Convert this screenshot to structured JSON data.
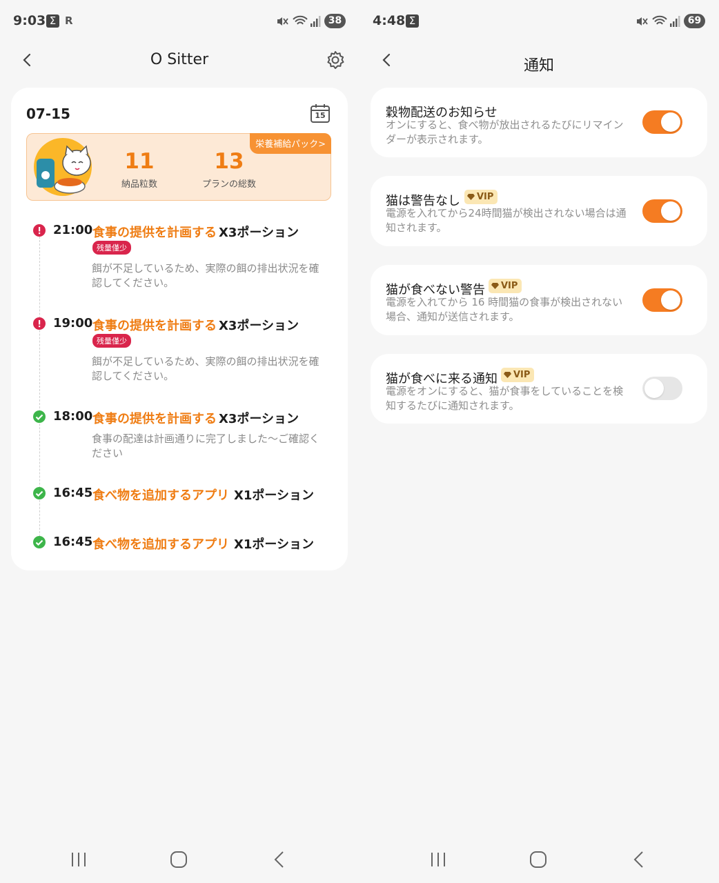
{
  "left": {
    "status": {
      "time": "9:03",
      "battery": "38"
    },
    "header": {
      "title": "O Sitter"
    },
    "card": {
      "date": "07-15",
      "calendar_day": "15",
      "summary": {
        "delivered_value": "11",
        "delivered_label": "納品粒数",
        "plans_value": "13",
        "plans_label": "プランの総数",
        "pack_label": "栄養補給パック>"
      },
      "timeline": [
        {
          "time": "21:00",
          "action": "食事の提供を計画する",
          "qty": "X3ポーション",
          "status": "warn",
          "badge": "残量僅少",
          "note": "餌が不足しているため、実際の餌の排出状況を確認してください。"
        },
        {
          "time": "19:00",
          "action": "食事の提供を計画する",
          "qty": "X3ポーション",
          "status": "warn",
          "badge": "残量僅少",
          "note": "餌が不足しているため、実際の餌の排出状況を確認してください。"
        },
        {
          "time": "18:00",
          "action": "食事の提供を計画する",
          "qty": "X3ポーション",
          "status": "ok",
          "note": "食事の配達は計画通りに完了しました〜ご確認ください"
        },
        {
          "time": "16:45",
          "action": "食べ物を追加するアプリ",
          "qty": "X1ポーション",
          "status": "ok"
        },
        {
          "time": "16:45",
          "action": "食べ物を追加するアプリ",
          "qty": "X1ポーション",
          "status": "ok"
        }
      ]
    }
  },
  "right": {
    "status": {
      "time": "4:48",
      "battery": "69"
    },
    "header": {
      "title": "通知"
    },
    "settings": [
      {
        "title": "穀物配送のお知らせ",
        "vip": false,
        "desc": "オンにすると、食べ物が放出されるたびにリマインダーが表示されます。",
        "enabled": true
      },
      {
        "title": "猫は警告なし",
        "vip": true,
        "vip_label": "VIP",
        "desc": "電源を入れてから24時間猫が検出されない場合は通知されます。",
        "enabled": true
      },
      {
        "title": "猫が食べない警告",
        "vip": true,
        "vip_label": "VIP",
        "desc": "電源を入れてから 16 時間猫の食事が検出されない場合、通知が送信されます。",
        "enabled": true
      },
      {
        "title": "猫が食べに来る通知",
        "vip": true,
        "vip_label": "VIP",
        "desc": "電源をオンにすると、猫が食事をしていることを検知するたびに通知されます。",
        "enabled": false
      }
    ]
  },
  "colors": {
    "accent": "#f57c22",
    "warn": "#d9254c",
    "ok": "#3db54a",
    "vip_bg": "#fbe7b4"
  },
  "icons": [
    "back-chevron-icon",
    "gear-icon",
    "calendar-icon",
    "sigma-icon",
    "mute-icon",
    "wifi-icon",
    "signal-icon",
    "recents-icon",
    "home-icon",
    "nav-back-icon"
  ]
}
